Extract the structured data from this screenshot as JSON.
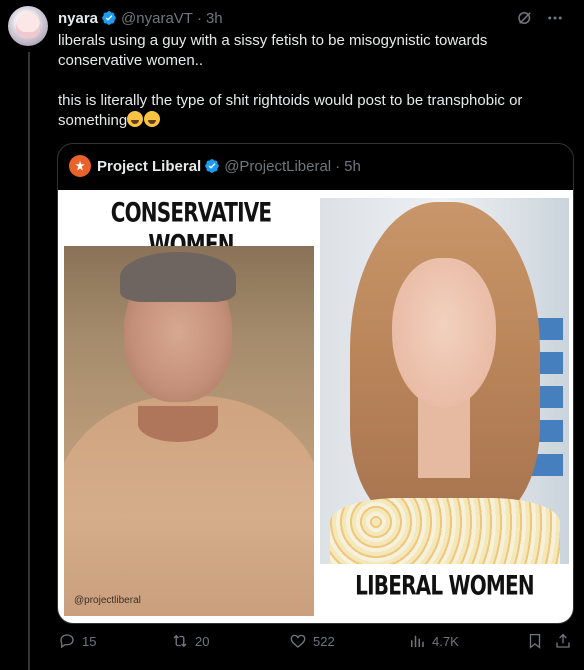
{
  "tweet": {
    "name": "nyara",
    "handle": "@nyaraVT",
    "time": "3h",
    "text_line1": "liberals using a guy with a sissy fetish to be misogynistic towards conservative women..",
    "text_line2": "this is literally the type of shit rightoids would post to be transphobic or something"
  },
  "quote": {
    "name": "Project Liberal",
    "handle": "@ProjectLiberal",
    "time": "5h",
    "image": {
      "left_title": "CONSERVATIVE WOMEN",
      "right_title": "LIBERAL WOMEN",
      "watermark": "@projectliberal"
    }
  },
  "actions": {
    "replies": "15",
    "reposts": "20",
    "likes": "522",
    "views": "4.7K"
  },
  "icons": {
    "verified": "verified-badge-icon",
    "grok": "grok-icon",
    "more": "more-icon",
    "reply": "reply-icon",
    "repost": "repost-icon",
    "like": "like-icon",
    "views": "views-icon",
    "bookmark": "bookmark-icon",
    "share": "share-icon"
  },
  "colors": {
    "accent": "#1d9bf0",
    "muted": "#71767b",
    "text": "#e7e9ea",
    "brand_orange": "#e8622a"
  }
}
